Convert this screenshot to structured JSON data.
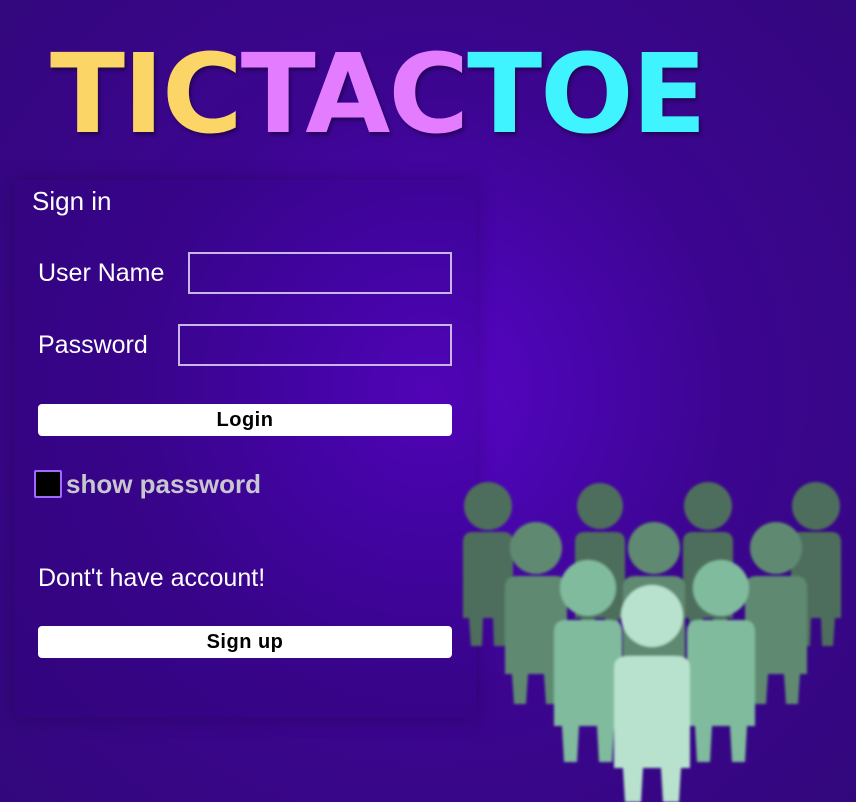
{
  "logo": {
    "tic": "TIC",
    "tac": "TAC",
    "toe": "TOE"
  },
  "signin": {
    "title": "Sign in",
    "username_label": "User Name",
    "username_value": "",
    "password_label": "Password",
    "password_value": "",
    "login_label": "Login",
    "show_password_label": "show password",
    "no_account_text": "Dont't have account!",
    "signup_label": "Sign up"
  },
  "colors": {
    "background": "#3c0590",
    "tic": "#fbd565",
    "tac": "#e37cff",
    "toe": "#3ff3ff"
  },
  "illustration": {
    "icon": "people-group-icon"
  }
}
